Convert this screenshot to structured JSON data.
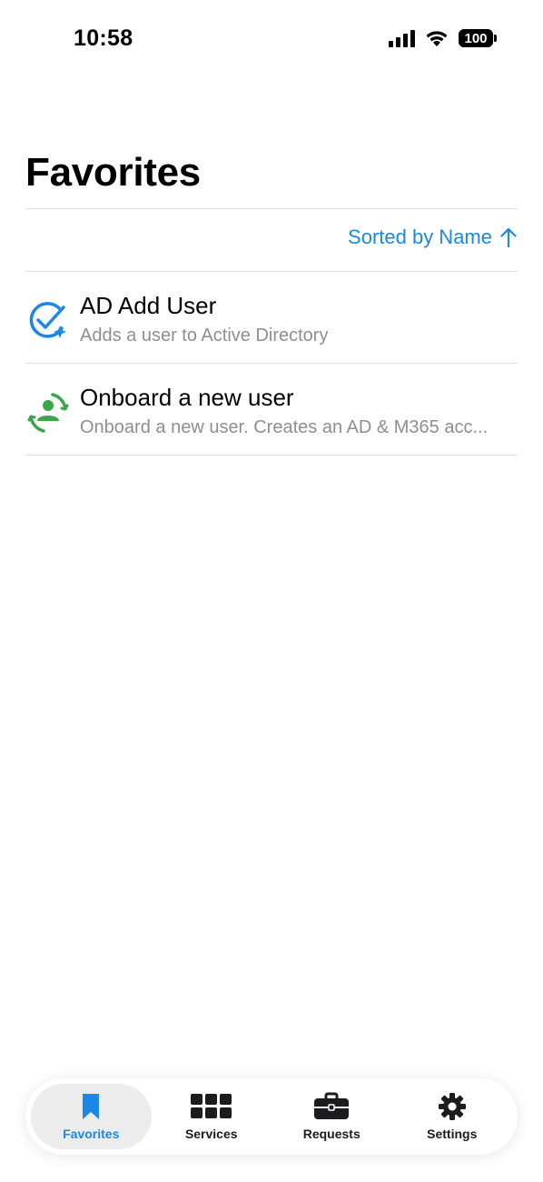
{
  "status_bar": {
    "time": "10:58",
    "battery": "100"
  },
  "page": {
    "title": "Favorites"
  },
  "sort": {
    "label": "Sorted by Name",
    "direction_icon": "arrow-up-icon"
  },
  "favorites": [
    {
      "title": "AD Add User",
      "subtitle": "Adds a user to Active Directory",
      "icon": "check-sparkle-icon",
      "icon_color": "#1a88e4"
    },
    {
      "title": "Onboard a new user",
      "subtitle": "Onboard a new user. Creates an AD & M365 acc...",
      "icon": "person-sync-icon",
      "icon_color": "#3aa64a"
    }
  ],
  "tab_bar": {
    "tabs": [
      {
        "label": "Favorites",
        "icon": "bookmark-icon",
        "active": true
      },
      {
        "label": "Services",
        "icon": "grid-icon",
        "active": false
      },
      {
        "label": "Requests",
        "icon": "briefcase-icon",
        "active": false
      },
      {
        "label": "Settings",
        "icon": "gear-icon",
        "active": false
      }
    ]
  },
  "colors": {
    "accent": "#1a88e4",
    "secondary_text": "#8e8e93",
    "success": "#3aa64a"
  }
}
